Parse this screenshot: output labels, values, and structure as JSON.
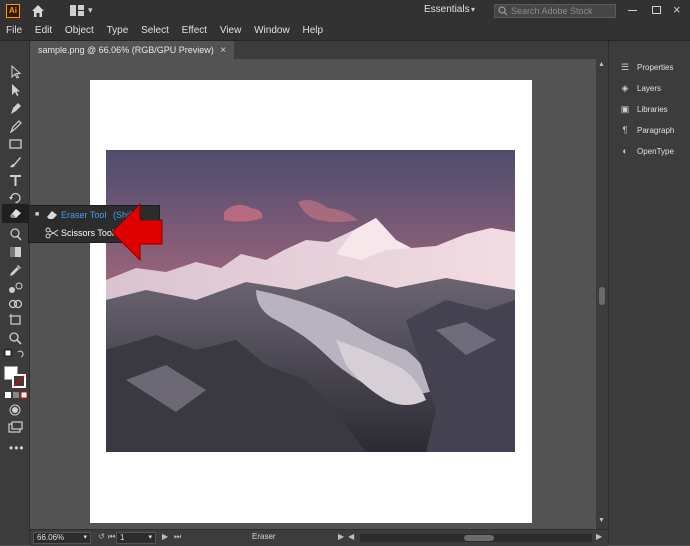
{
  "app": {
    "logo_text": "Ai"
  },
  "menu": [
    "File",
    "Edit",
    "Object",
    "Type",
    "Select",
    "Effect",
    "View",
    "Window",
    "Help"
  ],
  "workspace": {
    "label": "Essentials"
  },
  "search": {
    "placeholder": "Search Adobe Stock"
  },
  "document_tab": {
    "title": "sample.png @ 66.06% (RGB/GPU Preview)",
    "close": "×"
  },
  "flyout": {
    "items": [
      {
        "label": "Eraser Tool",
        "shortcut": "(Shift",
        "selected": true
      },
      {
        "label": "Scissors Tool",
        "shortcut": "",
        "selected": false
      }
    ]
  },
  "panels": [
    {
      "label": "Properties",
      "icon": "properties-icon"
    },
    {
      "label": "Layers",
      "icon": "layers-icon"
    },
    {
      "label": "Libraries",
      "icon": "libraries-icon"
    },
    {
      "label": "Paragraph",
      "icon": "paragraph-icon"
    },
    {
      "label": "OpenType",
      "icon": "opentype-icon"
    }
  ],
  "status": {
    "zoom": "66.06%",
    "artboard": "1",
    "tool": "Eraser"
  },
  "colors": {
    "accent_blue": "#4b9cf5",
    "arrow_red": "#e00000",
    "brand_orange": "#ff9a00"
  }
}
